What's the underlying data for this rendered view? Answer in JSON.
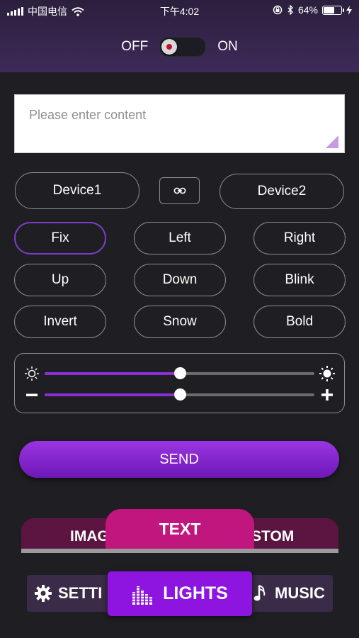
{
  "status_bar": {
    "carrier": "中国电信",
    "time": "下午4:02",
    "battery_text": "64%",
    "battery_level": 0.64,
    "icons": [
      "signal-icon",
      "wifi-icon",
      "rotation-lock-icon",
      "bluetooth-icon",
      "battery-icon",
      "charging-icon"
    ]
  },
  "power": {
    "off_label": "OFF",
    "on_label": "ON",
    "state": "off"
  },
  "text_input": {
    "placeholder": "Please enter content",
    "value": ""
  },
  "devices": {
    "device1_label": "Device1",
    "device2_label": "Device2",
    "link_icon": "link-icon"
  },
  "modes": {
    "selected": "Fix",
    "items": [
      "Fix",
      "Left",
      "Right",
      "Up",
      "Down",
      "Blink",
      "Invert",
      "Snow",
      "Bold"
    ]
  },
  "sliders": {
    "brightness": {
      "value": 0.5,
      "min_icon": "sun-dim-icon",
      "max_icon": "sun-bright-icon"
    },
    "speed": {
      "value": 0.5,
      "min_icon": "minus-icon",
      "max_icon": "plus-icon"
    }
  },
  "send": {
    "label": "SEND"
  },
  "top_tabs": {
    "image": "IMAG",
    "text": "TEXT",
    "custom": "STOM",
    "active": "TEXT"
  },
  "bottom_nav": {
    "settings": "SETTI",
    "lights": "LIGHTS",
    "music": "MUSIC",
    "active": "LIGHTS"
  },
  "colors": {
    "accent": "#8e14e0",
    "text_tab": "#c2167f",
    "tab_bar": "#5c1440",
    "background": "#1f1f23"
  }
}
